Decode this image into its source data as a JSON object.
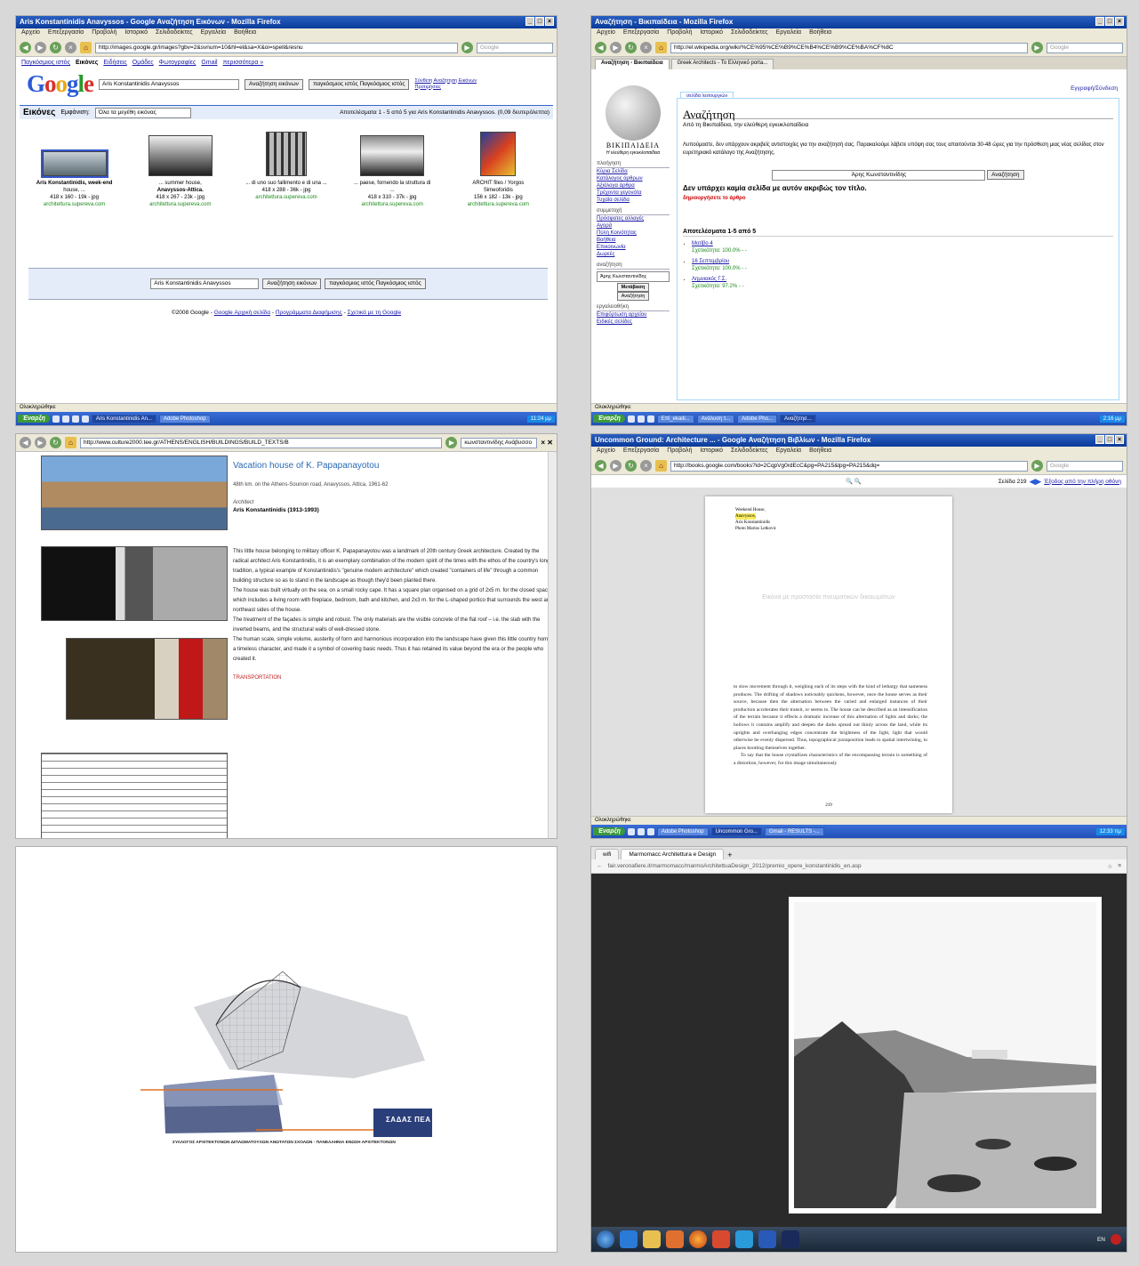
{
  "p1": {
    "title": "Aris Konstantinidis Anavyssos - Google Αναζήτηση Εικόνων - Mozilla Firefox",
    "menu": [
      "Αρχείο",
      "Επεξεργασία",
      "Προβολή",
      "Ιστορικό",
      "Σελιδοδείκτες",
      "Εργαλεία",
      "Βοήθεια"
    ],
    "url": "http://images.google.gr/images?gbv=2&svnum=10&hl=el&sa=X&oi=spell&resnu",
    "search_placeholder": "Google",
    "toplinks": [
      "Παγκόσμιος ιστός",
      "Εικόνες",
      "Ειδήσεις",
      "Ομάδες",
      "Φωτογραφίες",
      "Gmail",
      "περισσότερα »"
    ],
    "query": "Aris Konstantinidis Anavyssos",
    "btn_images": "Αναζήτηση εικόνων",
    "btn_web": "παγκόσμιος ιστός Παγκόσμιος ιστός",
    "adv": "Σύνθετη Αναζήτηση Εικόνων",
    "prefs": "Προτιμήσεις",
    "bar_label": "Εικόνες",
    "show_label": "Εμφάνιση:",
    "size_select": "Όλα τα μεγέθη εικόνας",
    "results": "Αποτελέσματα 1 - 5 από 5 για Aris Konstantinidis Anavyssos. (0,09 δευτερόλεπτα)",
    "thumbs": [
      {
        "l1": "Aris Konstantinidis, week-end",
        "l2": "house, ...",
        "l3": "418 x 160 - 19k - jpg",
        "site": "architettura.supereva.com"
      },
      {
        "l1": "... summer house,",
        "l2": "Anavyssos-Attica.",
        "l3": "418 x 267 - 23k - jpg",
        "site": "architettura.supereva.com"
      },
      {
        "l1": "... di uno suo fallimento e di una ...",
        "l2": "418 x 288 - 36k - jpg",
        "l3": "",
        "site": "architettura.supereva.com"
      },
      {
        "l1": "... paese, fornendo la struttura di",
        "l2": "...",
        "l3": "418 x 310 - 37k - jpg",
        "site": "architettura.supereva.com"
      },
      {
        "l1": "ARCHIT files / Yorgos",
        "l2": "Simeoforidis",
        "l3": "156 x 182 - 13k - jpg",
        "site": "architettura.supereva.com"
      }
    ],
    "footer": [
      "©2008 Google -",
      "Google Αρχική σελίδα",
      "-",
      "Προγράμματα Διαφήμισης",
      "-",
      "Σχετικά με τη Google"
    ],
    "status": "Ολοκληρώθηκε",
    "start": "Έναρξη",
    "tasks": [
      "Aris Konstantinidis An...",
      "Adobe Photoshop"
    ],
    "clock": "11:24 μμ"
  },
  "p2": {
    "title": "Αναζήτηση - Βικιπαίδεια - Mozilla Firefox",
    "url": "http://el.wikipedia.org/wiki/%CE%95%CE%B9%CE%B4%CE%B9%CE%BA%CF%8C",
    "tabs": [
      "Αναζήτηση - Βικιπαίδεια",
      "Greek Architects - Το Ελληνικό porta..."
    ],
    "login": "Εγγραφή/Σύνδεση",
    "specialtab": "σελίδα λειτουργιών",
    "wiki_name": "ΒΙΚΙΠΑΙΔΕΙΑ",
    "wiki_sub": "Η ελεύθερη εγκυκλοπαίδεια",
    "nav_head": "πλοήγηση",
    "nav": [
      "Κύρια Σελίδα",
      "Κατάλογος άρθρων",
      "Αξιόλογα άρθρα",
      "Τρέχοντα γεγονότα",
      "Τυχαία σελίδα"
    ],
    "part_head": "συμμετοχή",
    "part": [
      "Πρόσφατες αλλαγές",
      "Αγορά",
      "Πύλη Κοινότητας",
      "Βοήθεια",
      "Επικοινωνία",
      "Δωρεές"
    ],
    "search_head": "αναζήτηση",
    "search_val": "Άρης Κωνσταντινίδης",
    "go_btn": "Μετάβαση",
    "search_btn": "Αναζήτηση",
    "tools_head": "εργαλειοθήκη",
    "tools": [
      "Επιφόρτωση αρχείου",
      "Ειδικές σελίδες"
    ],
    "heading": "Αναζήτηση",
    "from": "Από τη Βικιπαίδεια, την ελεύθερη εγκυκλοπαίδεια",
    "note": "Λυπούμαστε, δεν υπάρχουν ακριβείς αντιστοιχίες για την αναζήτησή σας. Παρακαλούμε λάβετε υπόψη σας τους απαιτούνται 30-48 ώρες για την πρόσθεση μιας νέας σελίδας στον ευρετηριακό κατάλογο της Αναζήτησης.",
    "none": "Δεν υπάρχει καμία σελίδα με αυτόν ακριβώς τον τίτλο.",
    "create": "δημιουργήσετε το άρθρο",
    "results_head": "Αποτελέσματα 1-5 από 5",
    "results": [
      {
        "t": "Μοτίβο 4",
        "r": "Σχετικότητα: 100.0% - -"
      },
      {
        "t": "16 Σεπτεμβρίου",
        "r": "Σχετικότητα: 100.0% - -"
      },
      {
        "t": "Λημνιακός Γ.Σ.",
        "r": "Σχετικότητα: 97.2% - -"
      }
    ],
    "status": "Ολοκληρώθηκε",
    "start": "Έναρξη",
    "tasks": [
      "Επί_ekaiti...",
      "Ανάλυση τ...",
      "Adobe Pho...",
      "Αναζήτησ..."
    ],
    "clock": "2:16 μμ"
  },
  "p3": {
    "url": "http://www.culture2000.tee.gr/ATHENS/ENGLISH/BUILDINGS/BUILD_TEXTS/B",
    "search_val": "κωνσταντινίδης Ανάβυσσο",
    "title": "Vacation house of K. Papapanayotou",
    "loc": "48th km. on the Athens-Sounion road, Anavyssos, Attica, 1961-62",
    "arch_label": "Architect",
    "arch": "Aris Konstantinidis (1913-1993)",
    "body1": "This little house belonging to military officer K. Papapanayotou was a landmark of 20th century Greek architecture. Created by the radical architect Aris Konstantinidis, it is an exemplary combination of the modern spirit of the times with the ethos of the country's long tradition, a typical example of Konstantinidis's \"genuine modern architecture\" which created \"containers of life\" through a common building structure so as to stand in the landscape as though they'd been planted there.",
    "body2": "The house was built virtually on the sea, on a small rocky cape. It has a square plan organised on a grid of 2x5 m. for the closed space, which includes a living room with fireplace, bedroom, bath and kitchen, and 2x3 m. for the L-shaped portico that surrounds the west and northeast sides of the house.",
    "body3": "The treatment of the façades is simple and robust. The only materials are the visible concrete of the flat roof – i.e. the slab with the inverted beams, and the structural walls of well-dressed stone.",
    "body4": "The human scale, simple volume, austerity of form and harmonious incorporation into the landscape have given this little country home a timeless character, and made it a symbol of covering basic needs. Thus it has retained its value beyond the era or the people who created it.",
    "transport": "TRANSPORTATION"
  },
  "p4": {
    "title": "Uncommon Ground: Architecture ... - Google Αναζήτηση Βιβλίων - Mozilla Firefox",
    "url": "http://books.google.com/books?id=2CqpVg0rdEcC&pg=PA215&lpg=PA215&dq=",
    "page_label": "Σελίδα 219",
    "exit": "Έξοδος από την πλήρη οθόνη",
    "caption1": "Weekend House,",
    "caption_hl": "Anavyssos,",
    "caption2": "Aris Konstantinidis",
    "caption3": "Photo Marios Letkovic",
    "copyright": "Εικόνα με προστασία πνευματικών δικαιωμάτων",
    "text": "to slow movement through it, weighing each of its steps with the kind of lethargy that sameness produces. The drifting of shadows noticeably quickens, however, once the house serves as their source, because then the alternation between the varied and enlarged instances of their production accelerates their transit, or seems to. The house can be described as an intensification of the terrain because it effects a dramatic increase of this alternation of lights and darks; the hollows it contains amplify and deepen the darks spread out thinly across the land, while its uprights and overhanging edges concentrate the brightness of the light, light that would otherwise be evenly dispersed. Thus, topographical juxtaposition leads to spatial intertwining, to places knotting themselves together.",
    "text2": "To say that the house crystallizes characteristics of the encompassing terrain is something of a distortion, however, for this image simultaneously",
    "pagenum": "219",
    "status": "Ολοκληρώθηκε",
    "start": "Έναρξη",
    "tasks": [
      "Adobe Photoshop",
      "Uncommon Gro...",
      "Gmail - RESULTS -..."
    ],
    "clock": "12:33 πμ"
  },
  "p5": {
    "logo": "ΣΑΔΑΣ ΠΕΑ",
    "caption": "ΣΥΛΛΟΓΟΣ ΑΡΧΙΤΕΚΤΟΝΩΝ ΔΙΠΛΩΜΑΤΟΥΧΩΝ ΑΝΩΤΑΤΩΝ ΣΧΟΛΩΝ - ΠΑΝΕΛΛΗΝΙΑ ΕΝΩΣΗ ΑΡΧΙΤΕΚΤΟΝΩΝ"
  },
  "p6": {
    "tabs": [
      "wifi",
      "Marmomacc Architettura e Design"
    ],
    "url": "fair.veronafiere.it/marmomacc/marmoArchitettuaDesign_2012/premio_opere_konstantinidis_en.asp",
    "lang": "EN"
  }
}
